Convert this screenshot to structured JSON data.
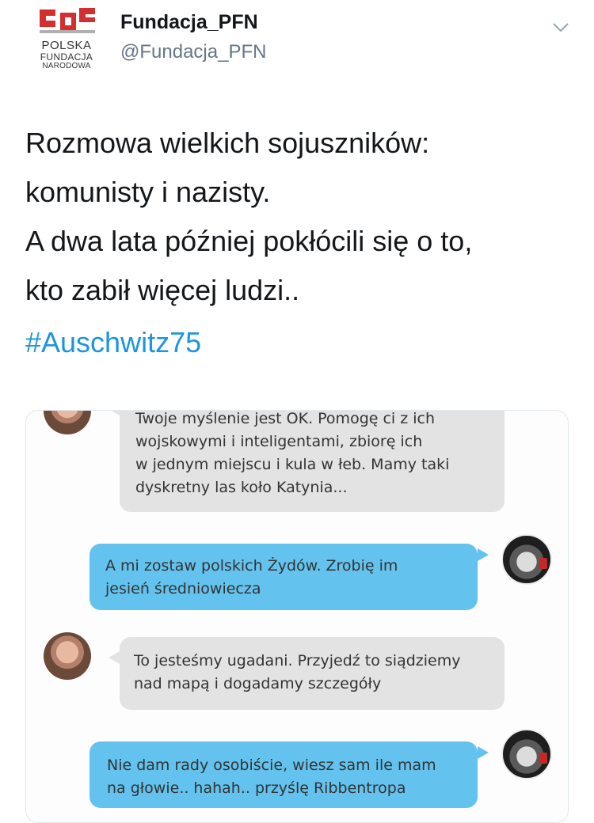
{
  "tweet": {
    "display_name": "Fundacja_PFN",
    "handle": "@Fundacja_PFN",
    "logo": {
      "line1": "POLSKA",
      "line2": "FUNDACJA",
      "line3": "NARODOWA"
    },
    "text_lines": [
      "Rozmowa wielkich sojuszników:",
      "komunisty i nazisty.",
      "A dwa lata później pokłócili się o to,",
      "kto zabił więcej ludzi.."
    ],
    "hashtag": "#Auschwitz75"
  },
  "chat": {
    "messages": [
      {
        "side": "left",
        "color": "gray",
        "lines": [
          "Twoje myślenie jest OK. Pomogę ci z ich",
          "wojskowymi i inteligentami, zbiorę ich",
          "w jednym miejscu i kula w łeb. Mamy taki",
          "dyskretny las koło Katynia..."
        ]
      },
      {
        "side": "right",
        "color": "blue",
        "lines": [
          "A mi zostaw polskich Żydów. Zrobię im",
          "jesień średniowiecza"
        ]
      },
      {
        "side": "left",
        "color": "gray",
        "lines": [
          "To jesteśmy ugadani. Przyjedź to siądziemy",
          "nad mapą i dogadamy szczegóły"
        ]
      },
      {
        "side": "right",
        "color": "blue",
        "lines": [
          "Nie dam rady osobiście, wiesz sam ile mam",
          "na głowie.. hahah.. przyślę Ribbentropa"
        ]
      }
    ]
  },
  "colors": {
    "link": "#1b95e0",
    "bubble_gray": "#e3e3e3",
    "bubble_blue": "#63c3ee"
  },
  "icons": [
    "foundation-logo",
    "chevron-down-icon"
  ]
}
